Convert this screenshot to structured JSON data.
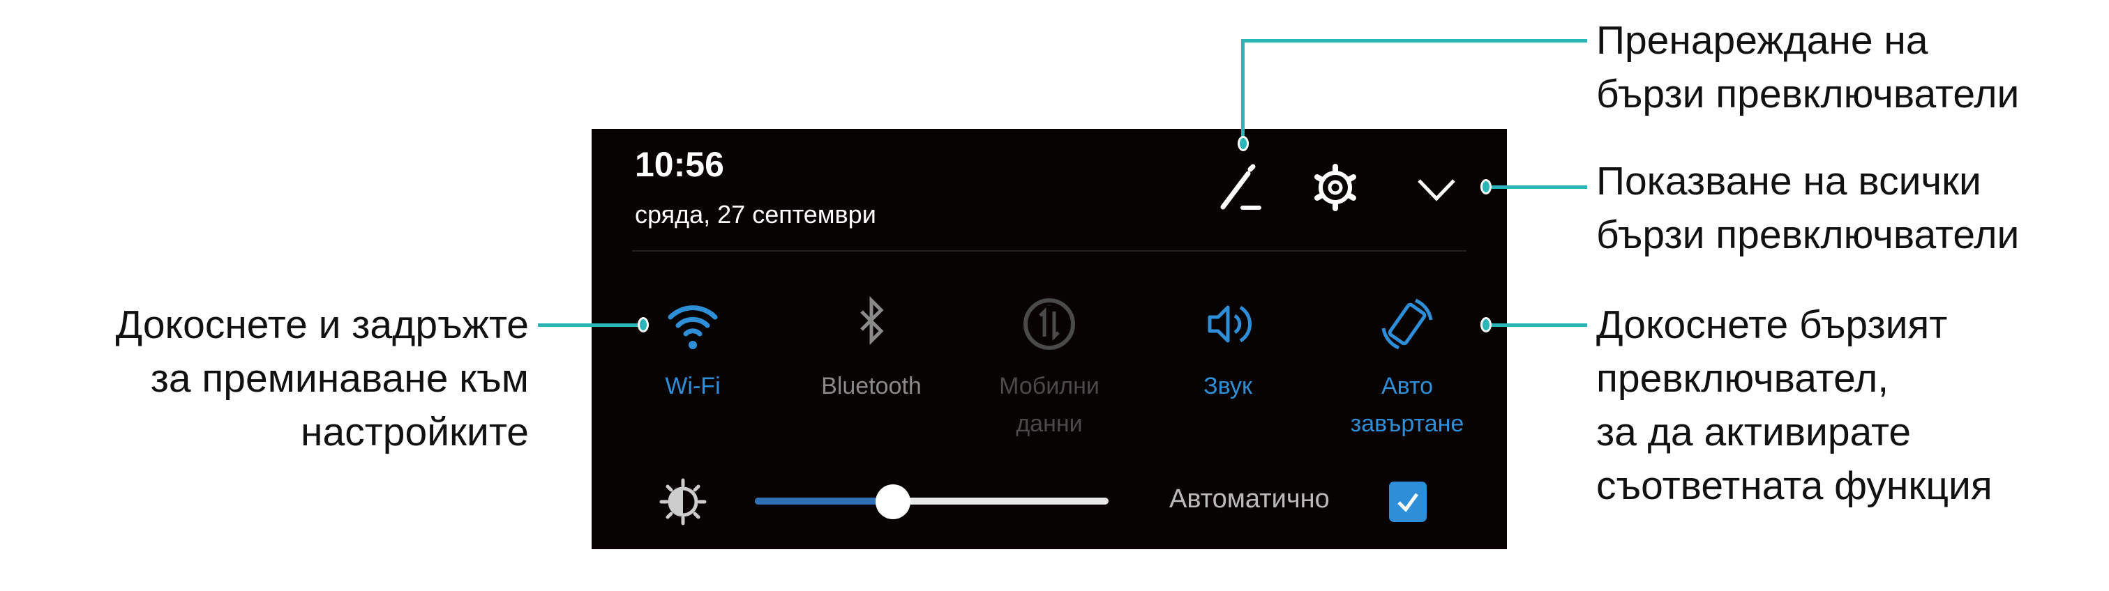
{
  "header": {
    "time": "10:56",
    "date": "сряда, 27 септември"
  },
  "icons": {
    "edit": "pencil-icon",
    "settings": "gear-icon",
    "expand": "chevron-down-icon"
  },
  "tiles": [
    {
      "label": "Wi-Fi",
      "label2": "",
      "icon": "wifi-icon",
      "state": "on"
    },
    {
      "label": "Bluetooth",
      "label2": "",
      "icon": "bluetooth-icon",
      "state": "off"
    },
    {
      "label": "Мобилни",
      "label2": "данни",
      "icon": "mobile-data-icon",
      "state": "disabled"
    },
    {
      "label": "Звук",
      "label2": "",
      "icon": "sound-icon",
      "state": "on"
    },
    {
      "label": "Авто",
      "label2": "завъртане",
      "icon": "auto-rotate-icon",
      "state": "on"
    }
  ],
  "brightness": {
    "level_percent": 39,
    "auto_label": "Автоматично",
    "auto_checked": true
  },
  "colors": {
    "accent": "#2e8fd8",
    "callout": "#2ab5b9",
    "panel": "#070303",
    "inactive": "#8a8a8a",
    "disabled": "#4a4a4a"
  },
  "annotations": {
    "reorder": [
      "Пренареждане на",
      "бързи превключватели"
    ],
    "show_all": [
      "Показване на всички",
      "бързи превключватели"
    ],
    "long_press": [
      "Докоснете и задръжте",
      "за преминаване към",
      "настройките"
    ],
    "tap": [
      "Докоснете бързият",
      "превключвател,",
      "за да активирате",
      "съответната функция"
    ]
  }
}
